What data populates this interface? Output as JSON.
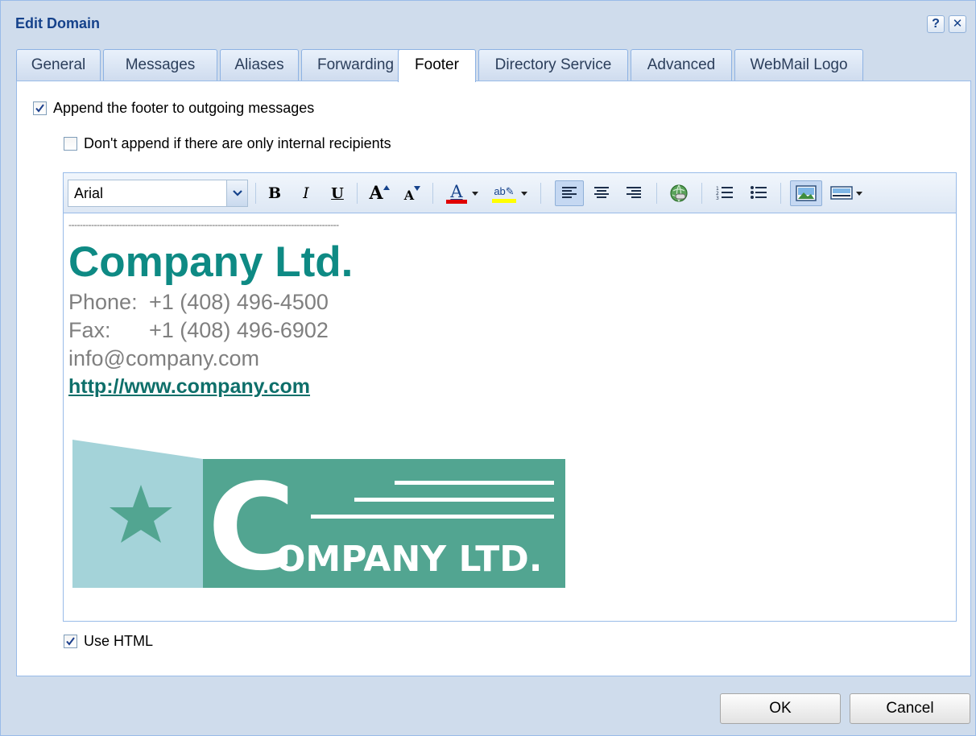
{
  "window": {
    "title": "Edit Domain",
    "help_label": "?",
    "close_label": "✕"
  },
  "tabs": [
    {
      "label": "General"
    },
    {
      "label": "Messages"
    },
    {
      "label": "Aliases"
    },
    {
      "label": "Forwarding"
    },
    {
      "label": "Footer",
      "active": true
    },
    {
      "label": "Directory Service"
    },
    {
      "label": "Advanced"
    },
    {
      "label": "WebMail Logo"
    }
  ],
  "options": {
    "append_footer": {
      "label": "Append the footer to outgoing messages",
      "checked": true
    },
    "dont_append_internal": {
      "label": "Don't append if there are only internal recipients",
      "checked": false
    },
    "use_html": {
      "label": "Use HTML",
      "checked": true
    }
  },
  "editor": {
    "font": "Arial",
    "toolbar": {
      "bold": "B",
      "italic": "I",
      "underline": "U",
      "grow_font": "A",
      "shrink_font": "A",
      "font_color": "A",
      "highlight": "ab"
    },
    "content": {
      "separator": "------------------------------------------------------------------------------------------------",
      "company": "Company Ltd.",
      "phone_label": "Phone:",
      "phone": "+1 (408) 496-4500",
      "fax_label": "Fax:",
      "fax": "+1 (408) 496-6902",
      "email": "info@company.com",
      "url": "http://www.company.com",
      "logo": {
        "big_letter": "C",
        "text": "OMPANY LTD.",
        "icon": "star-icon",
        "colors": {
          "light": "#a4d3d9",
          "dark": "#52a591"
        }
      }
    }
  },
  "buttons": {
    "ok": "OK",
    "cancel": "Cancel"
  },
  "colors": {
    "title": "#15428b",
    "accent_teal": "#0e8a84",
    "font_color_bar": "#e00000",
    "highlight_bar": "#ffff00"
  }
}
